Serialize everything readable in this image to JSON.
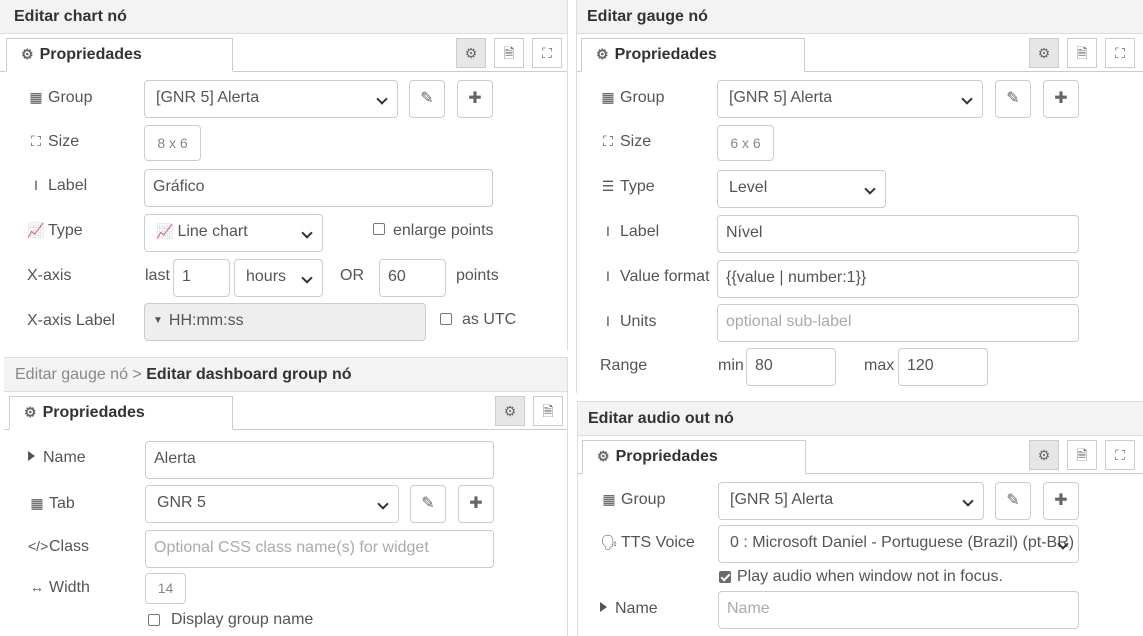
{
  "chart_panel": {
    "title": "Editar chart nó",
    "tab": "Propriedades",
    "group_label": "Group",
    "group_value": "[GNR 5] Alerta",
    "size_label": "Size",
    "size_value": "8 x 6",
    "label_label": "Label",
    "label_value": "Gráfico",
    "type_label": "Type",
    "type_value": "Line chart",
    "enlarge_label": "enlarge points",
    "enlarge_checked": false,
    "xaxis_label": "X-axis",
    "xaxis_last": "last",
    "xaxis_num": "1",
    "xaxis_unit": "hours",
    "xaxis_or": "OR",
    "xaxis_points_value": "60",
    "xaxis_points": "points",
    "xaxis_label_label": "X-axis Label",
    "xaxis_label_value": "HH:mm:ss",
    "utc_label": "as UTC",
    "utc_checked": false
  },
  "group_panel": {
    "crumb": "Editar gauge nó >",
    "title": "Editar dashboard group nó",
    "tab": "Propriedades",
    "name_label": "Name",
    "name_value": "Alerta",
    "tab_label": "Tab",
    "tab_value": "GNR 5",
    "class_label": "Class",
    "class_placeholder": "Optional CSS class name(s) for widget",
    "width_label": "Width",
    "width_value": "14",
    "display_name_label": "Display group name",
    "display_name_checked": false
  },
  "gauge_panel": {
    "title": "Editar gauge nó",
    "tab": "Propriedades",
    "group_label": "Group",
    "group_value": "[GNR 5] Alerta",
    "size_label": "Size",
    "size_value": "6 x 6",
    "type_label": "Type",
    "type_value": "Level",
    "label_label": "Label",
    "label_value": "Nível",
    "format_label": "Value format",
    "format_value": "{{value | number:1}}",
    "units_label": "Units",
    "units_placeholder": "optional sub-label",
    "range_label": "Range",
    "min_label": "min",
    "min_value": "80",
    "max_label": "max",
    "max_value": "120"
  },
  "audio_panel": {
    "title": "Editar audio out nó",
    "tab": "Propriedades",
    "group_label": "Group",
    "group_value": "[GNR 5] Alerta",
    "tts_label": "TTS Voice",
    "tts_value": "0 : Microsoft Daniel - Portuguese (Brazil) (pt-BR)",
    "play_label": "Play audio when window not in focus.",
    "play_checked": true,
    "name_label": "Name",
    "name_placeholder": "Name"
  }
}
